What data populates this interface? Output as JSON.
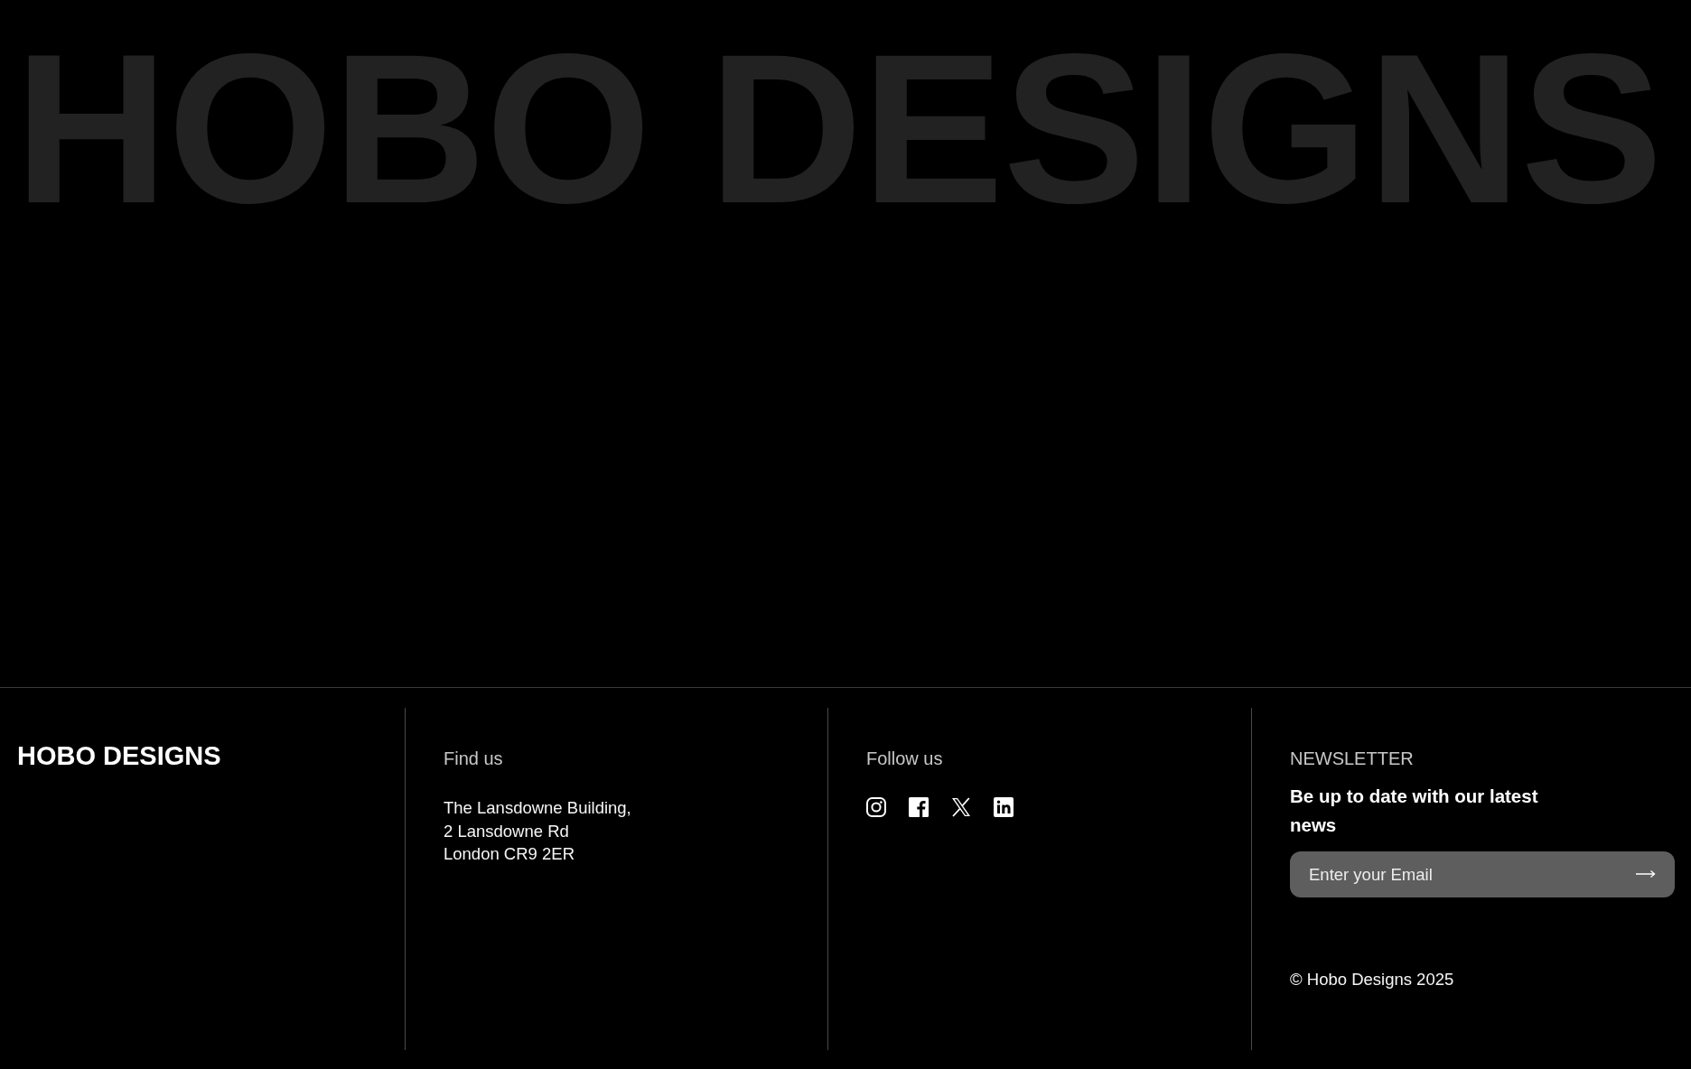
{
  "hero": {
    "title": "HOBO DESIGNS"
  },
  "footer": {
    "brand": "HOBO DESIGNS",
    "find_us": {
      "heading": "Find us",
      "address_lines": [
        "The Lansdowne Building,",
        "2 Lansdowne Rd",
        "London CR9 2ER"
      ]
    },
    "follow_us": {
      "heading": "Follow us"
    },
    "newsletter": {
      "heading": "NEWSLETTER",
      "text": "Be up to date with our latest news",
      "email_field": {
        "placeholder": "Enter your Email"
      }
    },
    "copyright": "© Hobo Designs 2025"
  }
}
